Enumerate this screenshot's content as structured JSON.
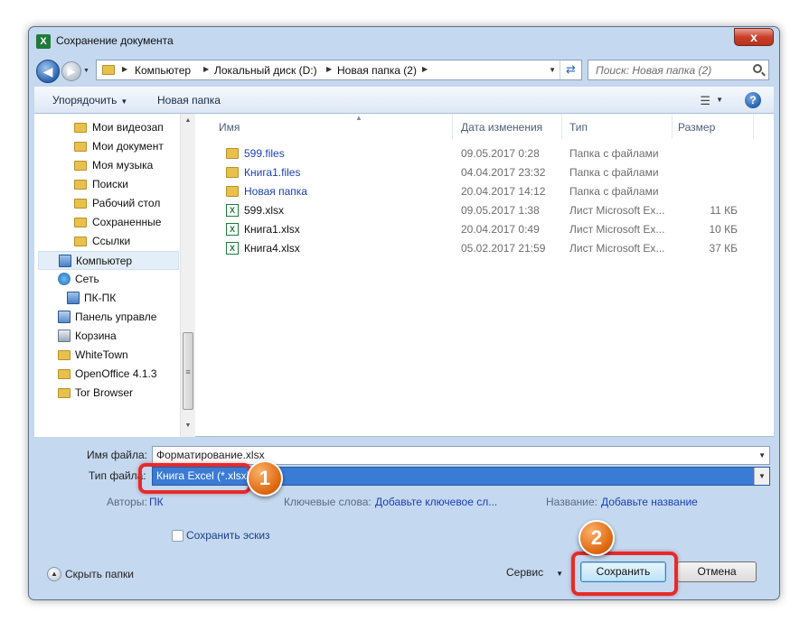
{
  "window": {
    "title": "Сохранение документа",
    "app_icon": "X",
    "close_glyph": "x"
  },
  "nav": {
    "breadcrumb": [
      "Компьютер",
      "Локальный диск (D:)",
      "Новая папка (2)"
    ],
    "search_placeholder": "Поиск: Новая папка (2)"
  },
  "toolbar": {
    "organize": "Упорядочить",
    "new_folder": "Новая папка",
    "help": "?"
  },
  "sidebar": {
    "items": [
      {
        "label": "Мои видеозап",
        "icon": "folder-icon"
      },
      {
        "label": "Мои документ",
        "icon": "folder-icon"
      },
      {
        "label": "Моя музыка",
        "icon": "folder-icon"
      },
      {
        "label": "Поиски",
        "icon": "folder-icon"
      },
      {
        "label": "Рабочий стол",
        "icon": "folder-icon"
      },
      {
        "label": "Сохраненные",
        "icon": "folder-icon"
      },
      {
        "label": "Ссылки",
        "icon": "folder-icon"
      },
      {
        "label": "Компьютер",
        "icon": "computer-icon",
        "selected": true
      },
      {
        "label": "Сеть",
        "icon": "network-icon"
      },
      {
        "label": "ПК-ПК",
        "icon": "computer-icon"
      },
      {
        "label": "Панель управле",
        "icon": "control-panel-icon"
      },
      {
        "label": "Корзина",
        "icon": "recycle-bin-icon"
      },
      {
        "label": "WhiteTown",
        "icon": "folder-icon"
      },
      {
        "label": "OpenOffice 4.1.3",
        "icon": "folder-icon"
      },
      {
        "label": "Tor Browser",
        "icon": "folder-icon"
      }
    ]
  },
  "columns": {
    "name": "Имя",
    "date": "Дата изменения",
    "type": "Тип",
    "size": "Размер"
  },
  "files": [
    {
      "name": "599.files",
      "date": "09.05.2017 0:28",
      "type": "Папка с файлами",
      "size": "",
      "kind": "folder"
    },
    {
      "name": "Книга1.files",
      "date": "04.04.2017 23:32",
      "type": "Папка с файлами",
      "size": "",
      "kind": "folder"
    },
    {
      "name": "Новая папка",
      "date": "20.04.2017 14:12",
      "type": "Папка с файлами",
      "size": "",
      "kind": "folder"
    },
    {
      "name": "599.xlsx",
      "date": "09.05.2017 1:38",
      "type": "Лист Microsoft Ex...",
      "size": "11 КБ",
      "kind": "xlsx"
    },
    {
      "name": "Книга1.xlsx",
      "date": "20.04.2017 0:49",
      "type": "Лист Microsoft Ex...",
      "size": "10 КБ",
      "kind": "xlsx"
    },
    {
      "name": "Книга4.xlsx",
      "date": "05.02.2017 21:59",
      "type": "Лист Microsoft Ex...",
      "size": "37 КБ",
      "kind": "xlsx"
    }
  ],
  "form": {
    "filename_label": "Имя файла:",
    "filename_value": "Форматирование.xlsx",
    "filetype_label": "Тип файла:",
    "filetype_value": "Книга Excel (*.xlsx)",
    "authors_label": "Авторы:",
    "authors_value": "ПК",
    "keywords_label": "Ключевые слова:",
    "keywords_value": "Добавьте ключевое сл...",
    "title_label": "Название:",
    "title_value": "Добавьте название",
    "thumbnail_label": "Сохранить эскиз"
  },
  "footer": {
    "hide_folders": "Скрыть папки",
    "service": "Сервис",
    "save": "Сохранить",
    "cancel": "Отмена"
  },
  "annotations": {
    "step1": "1",
    "step2": "2"
  },
  "colors": {
    "highlight": "#e52b2b",
    "badge": "#e06a12",
    "accent": "#3a7bd5"
  }
}
